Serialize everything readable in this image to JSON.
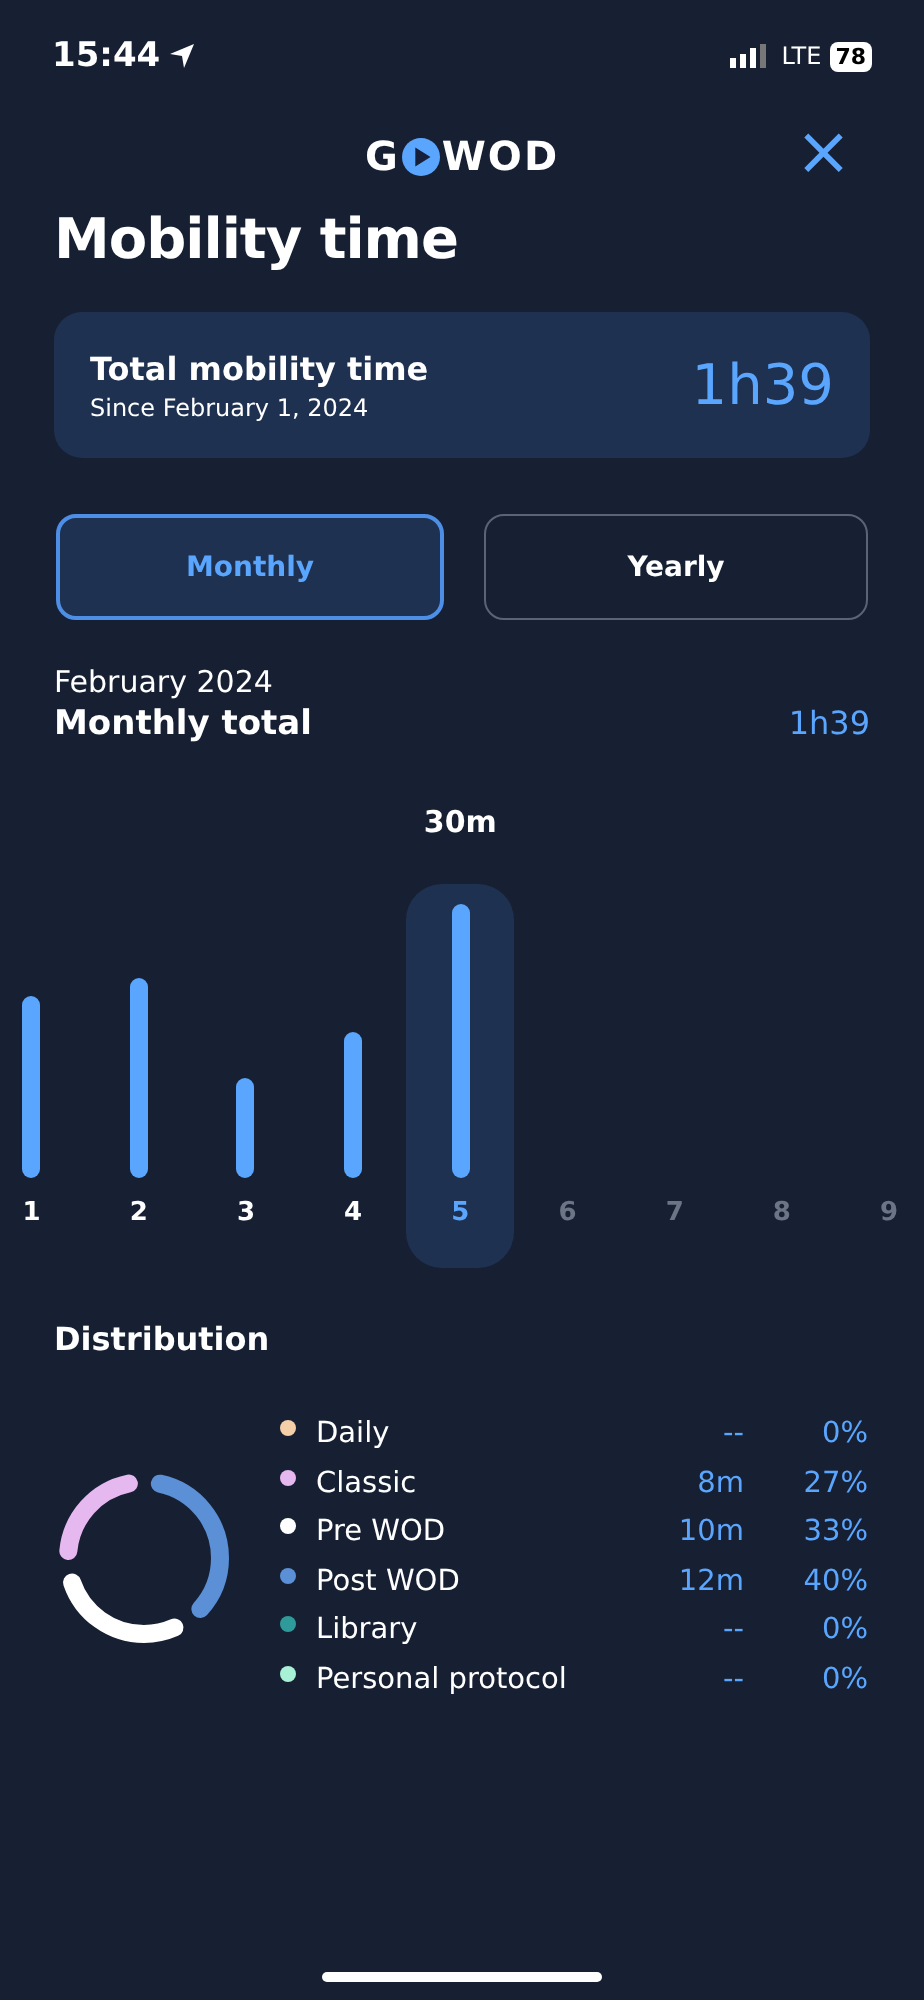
{
  "status_bar": {
    "time": "15:44",
    "network": "LTE",
    "battery": "78"
  },
  "header": {
    "logo_left": "G",
    "logo_right": "WOD",
    "close": "×"
  },
  "title": "Mobility time",
  "summary": {
    "label": "Total mobility time",
    "since": "Since February 1, 2024",
    "value": "1h39"
  },
  "period_tabs": [
    {
      "label": "Monthly",
      "selected": true
    },
    {
      "label": "Yearly",
      "selected": false
    }
  ],
  "month": "February 2024",
  "total_label": "Monthly total",
  "total_value": "1h39",
  "selected_value": "30m",
  "days": [
    {
      "label": "1",
      "dimmed": false,
      "selected": false
    },
    {
      "label": "2",
      "dimmed": false,
      "selected": false
    },
    {
      "label": "3",
      "dimmed": false,
      "selected": false
    },
    {
      "label": "4",
      "dimmed": false,
      "selected": false
    },
    {
      "label": "5",
      "dimmed": false,
      "selected": true
    },
    {
      "label": "6",
      "dimmed": true,
      "selected": false
    },
    {
      "label": "7",
      "dimmed": true,
      "selected": false
    },
    {
      "label": "8",
      "dimmed": true,
      "selected": false
    },
    {
      "label": "9",
      "dimmed": true,
      "selected": false
    }
  ],
  "distribution": {
    "title": "Distribution",
    "items": [
      {
        "name": "Daily",
        "time": "--",
        "percent": "0%",
        "color": "#f5cfa8"
      },
      {
        "name": "Classic",
        "time": "8m",
        "percent": "27%",
        "color": "#e6b8f0"
      },
      {
        "name": "Pre WOD",
        "time": "10m",
        "percent": "33%",
        "color": "#ffffff"
      },
      {
        "name": "Post WOD",
        "time": "12m",
        "percent": "40%",
        "color": "#5b8fd6"
      },
      {
        "name": "Library",
        "time": "--",
        "percent": "0%",
        "color": "#2f9a9a"
      },
      {
        "name": "Personal protocol",
        "time": "--",
        "percent": "0%",
        "color": "#a8f0d6"
      }
    ]
  }
}
